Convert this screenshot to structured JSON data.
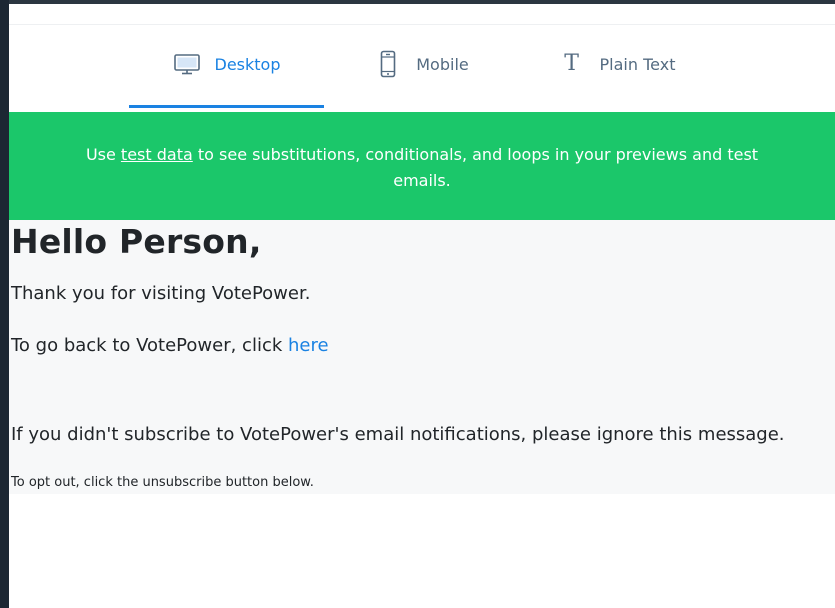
{
  "tabs": [
    {
      "label": "Desktop",
      "icon": "monitor-icon",
      "active": true
    },
    {
      "label": "Mobile",
      "icon": "phone-icon",
      "active": false
    },
    {
      "label": "Plain Text",
      "icon": "text-icon",
      "active": false
    }
  ],
  "banner": {
    "prefix": "Use ",
    "link": "test data",
    "suffix": " to see substitutions, conditionals, and loops in your previews and test emails."
  },
  "email": {
    "greeting": "Hello Person,",
    "thanks": "Thank you for visiting VotePower.",
    "back_text": "To go back to VotePower, click ",
    "back_link": "here",
    "ignore": "If you didn't subscribe to VotePower's email notifications, please ignore this message.",
    "opt_out": "To opt out, click the unsubscribe button below."
  },
  "colors": {
    "accent": "#1a82e2",
    "banner": "#1bc76a",
    "rail": "#1c2733"
  }
}
